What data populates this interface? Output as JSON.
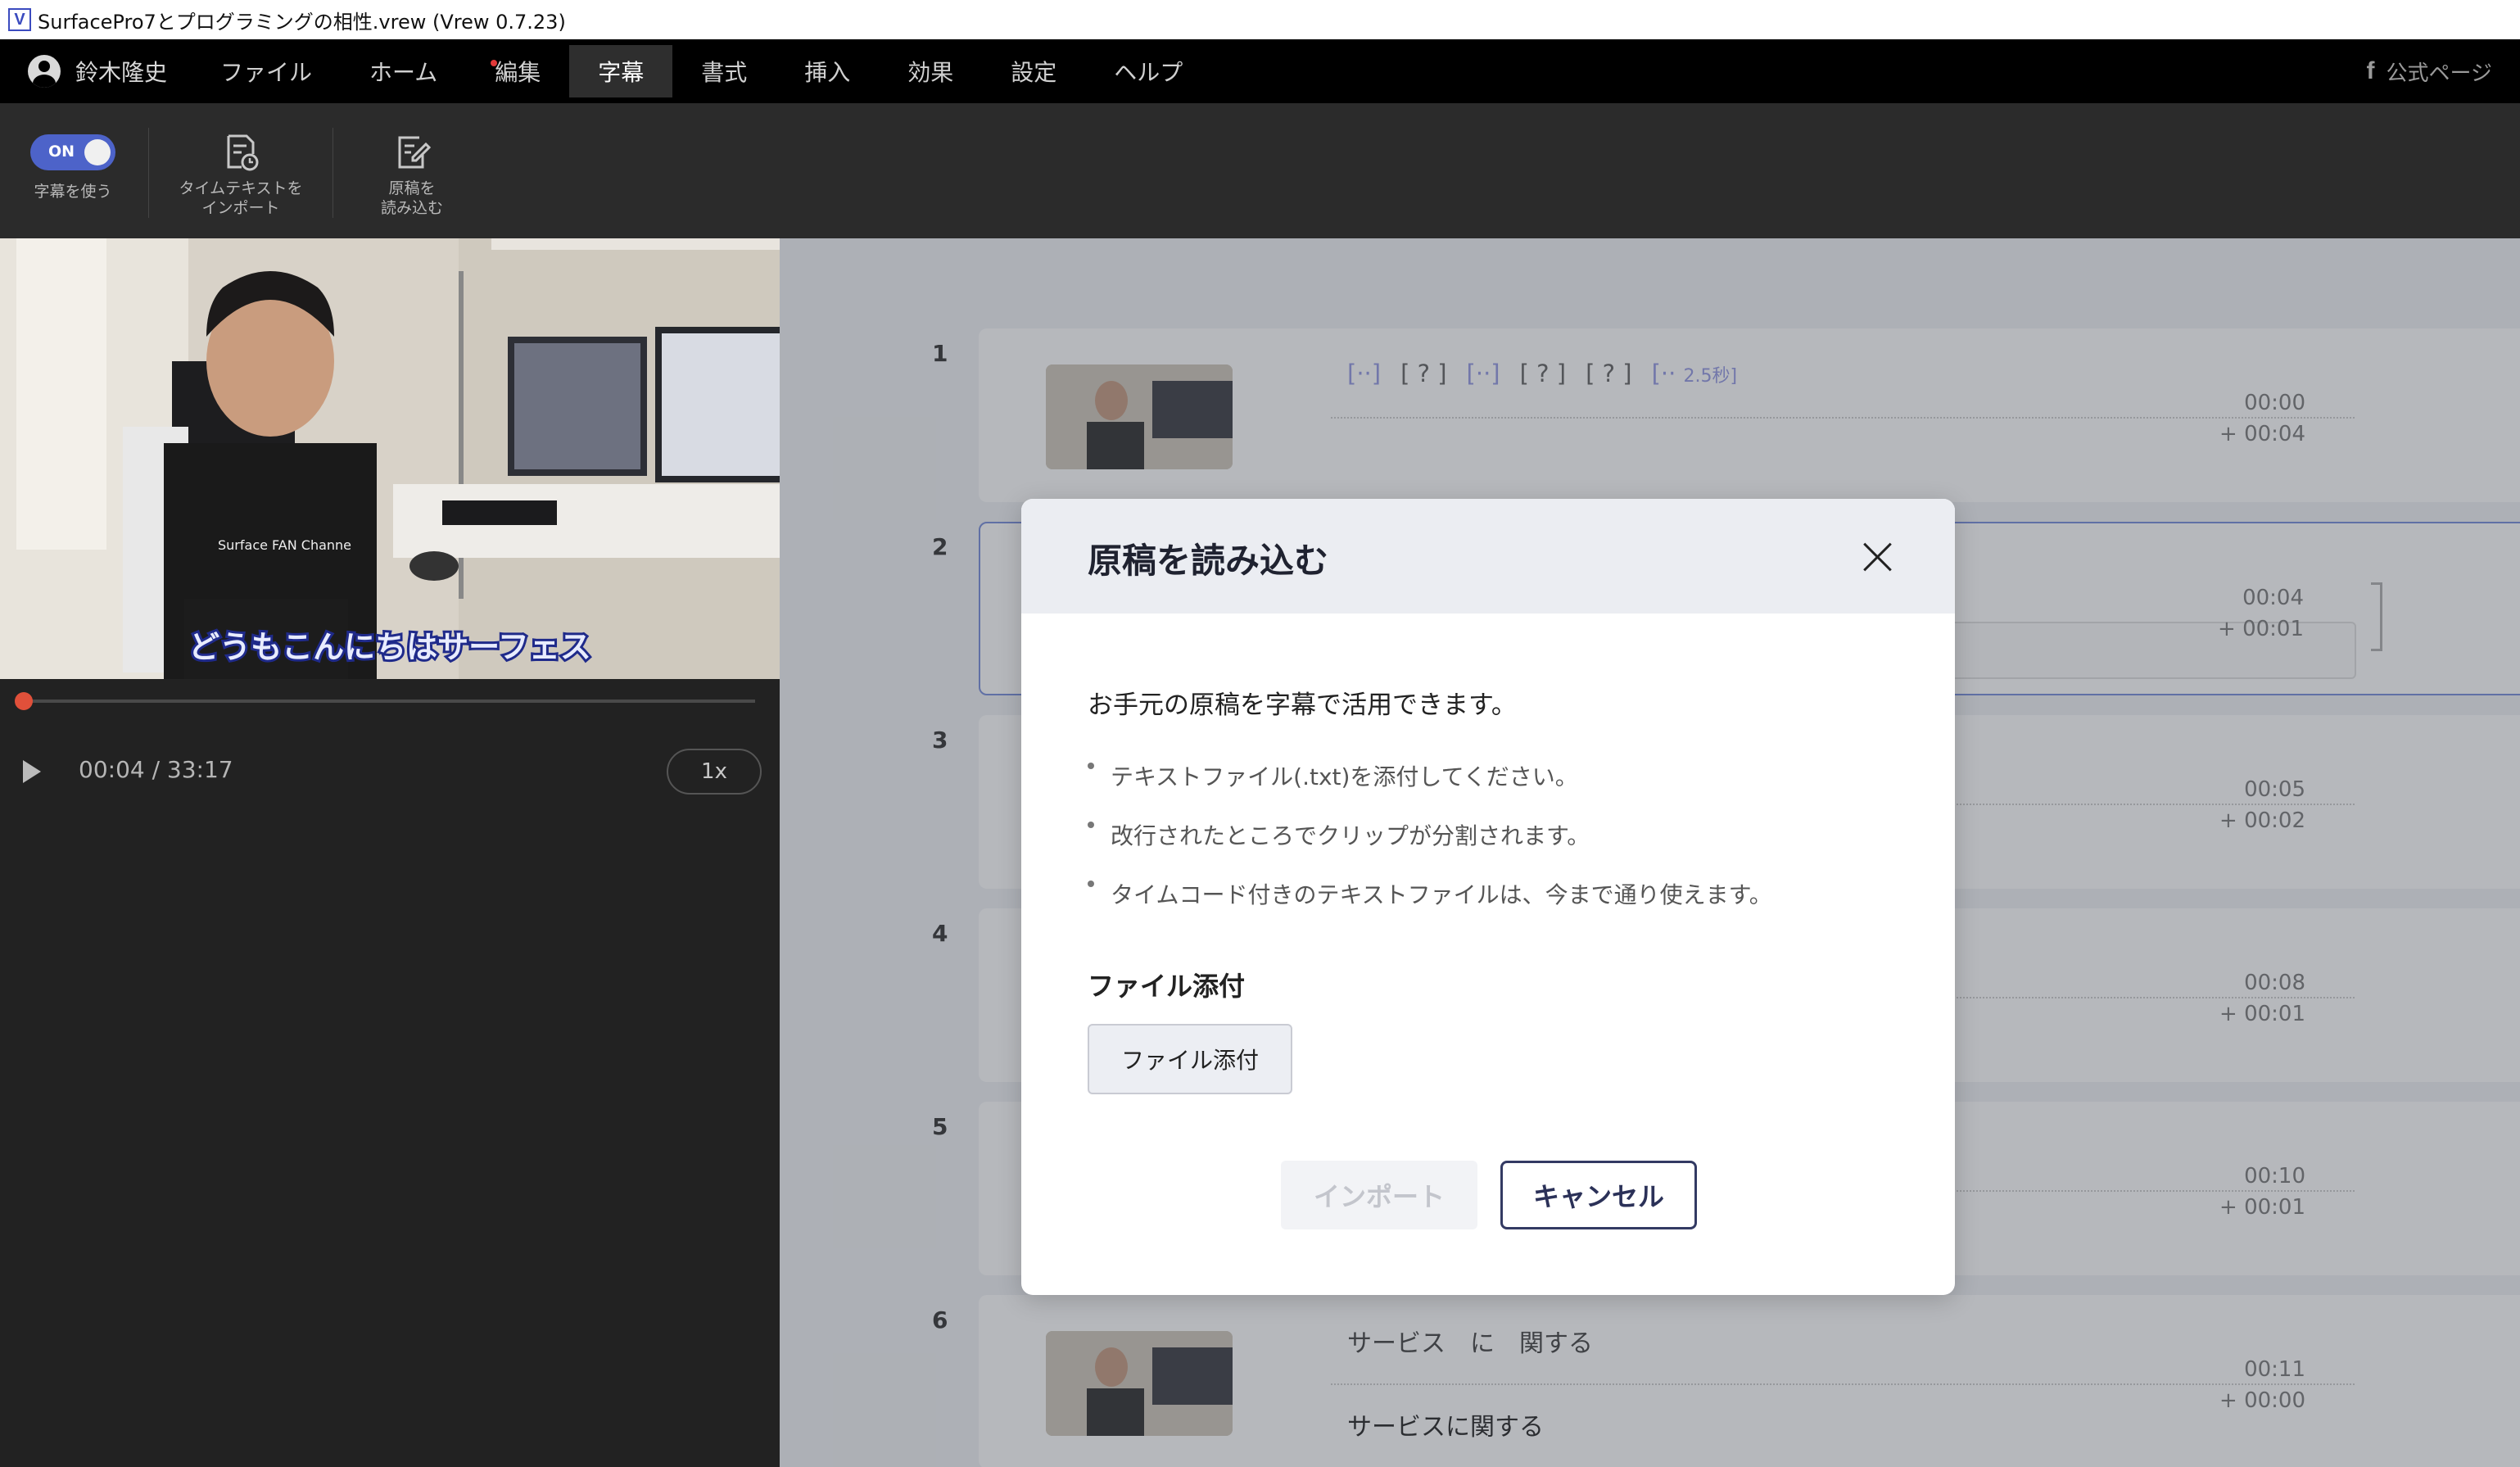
{
  "window": {
    "title": "SurfacePro7とプログラミングの相性.vrew (Vrew 0.7.23)",
    "app_icon_letter": "V"
  },
  "menubar": {
    "user_name": "鈴木隆史",
    "items": [
      "ファイル",
      "ホーム",
      "編集",
      "字幕",
      "書式",
      "挿入",
      "効果",
      "設定",
      "ヘルプ"
    ],
    "active_item": "字幕",
    "official_page": "公式ページ",
    "fb_letter": "f"
  },
  "toolbar": {
    "toggle_label": "ON",
    "toggle_caption": "字幕を使う",
    "import_time_text": "タイムテキストを\nインポート",
    "load_script": "原稿を\n読み込む"
  },
  "player": {
    "subtitle": "どうもこんにちはサーフェス",
    "shirt_text": "Surface FAN Channe",
    "timecode": "00:04 / 33:17",
    "speed": "1x",
    "progress": 0.002
  },
  "clips": [
    {
      "num": "1",
      "time_start": "00:00",
      "time_dur": "+ 00:04",
      "words": [
        "[··]",
        "[ ? ]",
        "[··]",
        "[ ? ]",
        "[ ? ]",
        "[··",
        "2.5秒]"
      ]
    },
    {
      "num": "2",
      "time_start": "00:04",
      "time_dur": "+ 00:01"
    },
    {
      "num": "3",
      "time_start": "00:05",
      "time_dur": "+ 00:02"
    },
    {
      "num": "4",
      "time_start": "00:08",
      "time_dur": "+ 00:01"
    },
    {
      "num": "5",
      "time_start": "00:10",
      "time_dur": "+ 00:01"
    },
    {
      "num": "6",
      "time_start": "00:11",
      "time_dur": "+ 00:00",
      "words_line": "サービス　に　関する",
      "text_line": "サービスに関する"
    }
  ],
  "dialog": {
    "title": "原稿を読み込む",
    "intro": "お手元の原稿を字幕で活用できます。",
    "bullets": [
      "テキストファイル(.txt)を添付してください。",
      "改行されたところでクリップが分割されます。",
      "タイムコード付きのテキストファイルは、今まで通り使えます。"
    ],
    "section_label": "ファイル添付",
    "attach_button": "ファイル添付",
    "import_button": "インポート",
    "cancel_button": "キャンセル"
  },
  "colors": {
    "accent": "#4d63c9",
    "menubar_bg": "#000000",
    "toolbar_bg": "#2b2b2b",
    "panel_bg": "#222222"
  }
}
